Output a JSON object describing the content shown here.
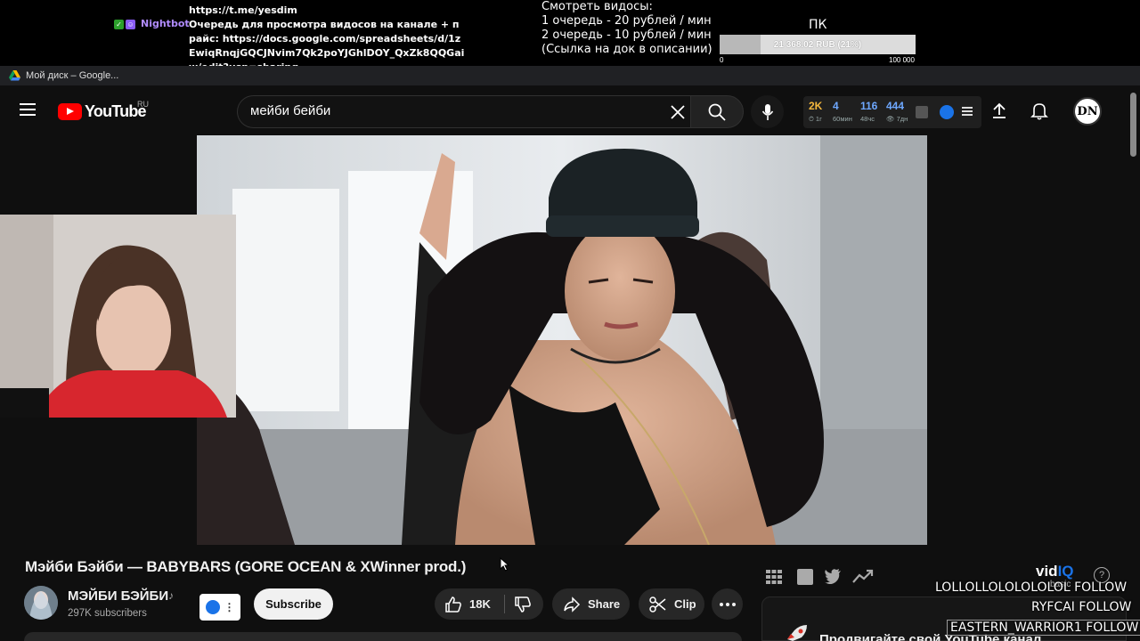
{
  "stream_overlay": {
    "chat_prev_line": "https://t.me/yesdim",
    "chat_user": "Nightbot",
    "chat_message": "Очередь для просмотра видосов на канале + прайс: https://docs.google.com/spreadsheets/d/1zEwiqRnqjGQCJNvim7Qk2poYJGhlDOY_QxZk8QQGaiw/edit?usp=sharing",
    "queue_info": [
      "Смотреть видосы:",
      "1 очередь - 20 рублей / мин",
      "2 очередь - 10 рублей / мин",
      "(Ссылка на док в описании)"
    ],
    "goal_label": "ПК",
    "goal_text": "21 368.02 RUB (21%)",
    "goal_fraction": 0.21,
    "goal_min": "0",
    "goal_max": "100 000"
  },
  "browser": {
    "bookmark_label": "Мой диск – Google..."
  },
  "youtube": {
    "logo_text": "YouTube",
    "region": "RU",
    "search_value": "мейби бейби",
    "vidiq_stats": [
      {
        "value": "2K",
        "sub": "⏱ 1г"
      },
      {
        "value": "4",
        "sub": "60мин"
      },
      {
        "value": "116",
        "sub": "48чс"
      },
      {
        "value": "444",
        "sub": "👁 7дн"
      }
    ],
    "account_initials": "DN"
  },
  "video": {
    "title": "Мэйби Бэйби — BABYBARS (GORE OCEAN & XWinner prod.)",
    "channel_name": "МЭЙБИ БЭЙБИ",
    "channel_subs": "297K subscribers",
    "subscribe_label": "Subscribe",
    "like_count": "18K",
    "share_label": "Share",
    "clip_label": "Clip"
  },
  "vidiq_panel": {
    "brand": "vidIQ",
    "tier": "basic",
    "promo_text": "Продвигайте свой YouTube канал"
  },
  "follow_alerts": [
    "LOLLOLLOLOLOLOLOL FOLLOW",
    "RYFCAI  FOLLOW",
    "EASTERN_WARRIOR1 FOLLOW"
  ],
  "colors": {
    "youtube_red": "#ff0000",
    "vidiq_blue": "#1a73e8",
    "nightbot_purple": "#b18cff"
  }
}
